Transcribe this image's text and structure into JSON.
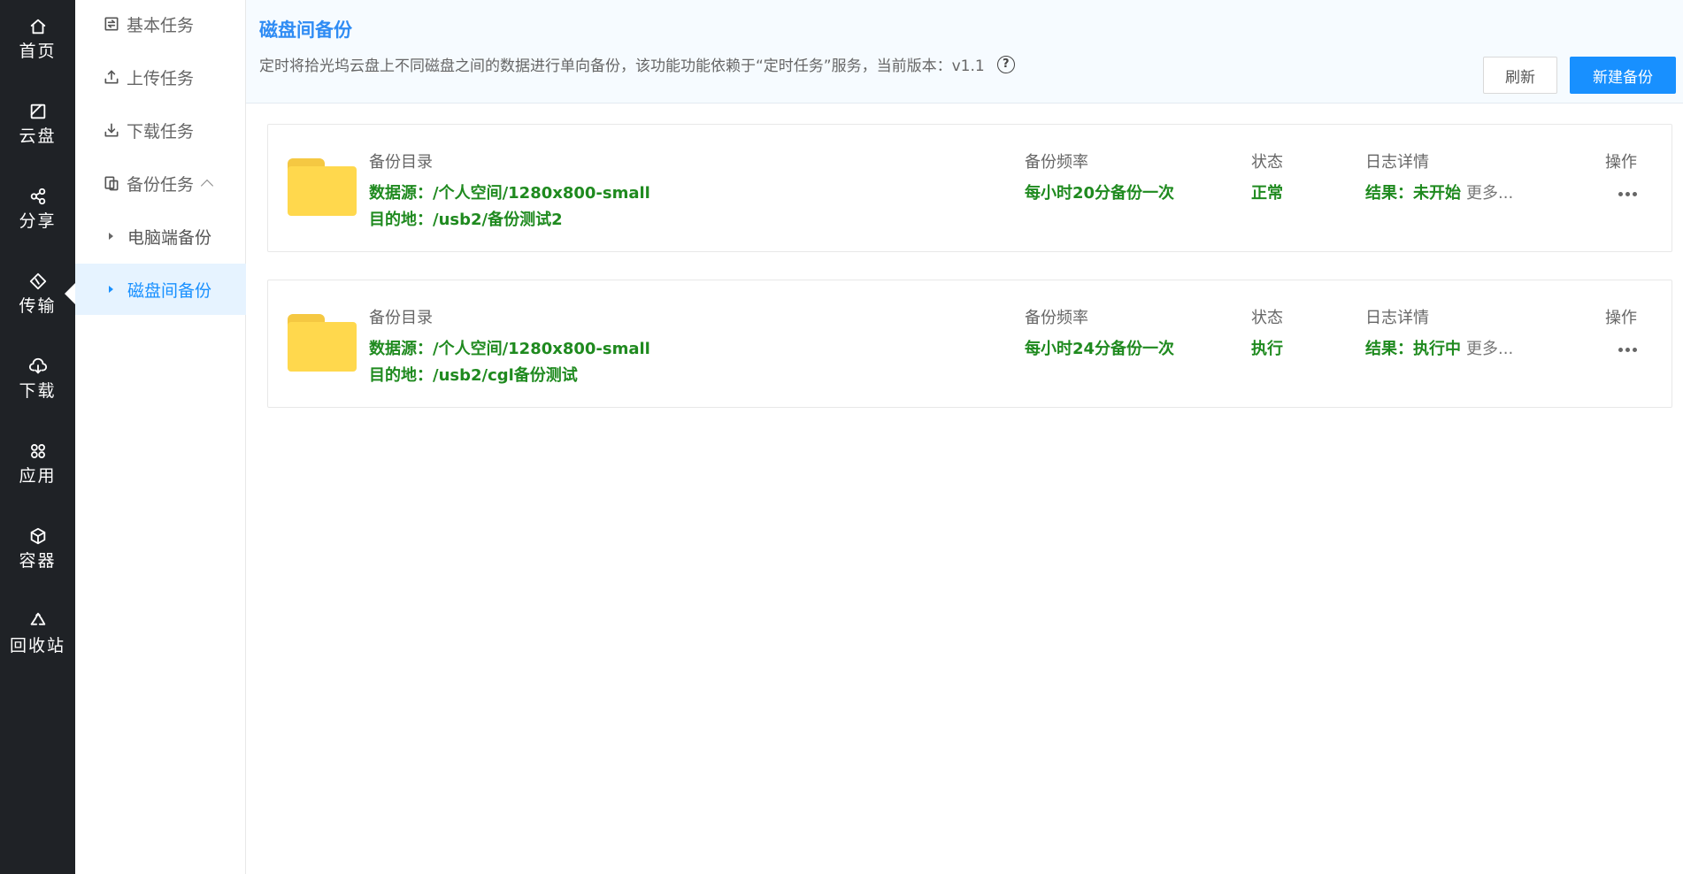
{
  "nav": {
    "items": [
      {
        "label": "首页",
        "icon": "home-icon"
      },
      {
        "label": "云盘",
        "icon": "cloud-disk-icon"
      },
      {
        "label": "分享",
        "icon": "share-icon"
      },
      {
        "label": "传输",
        "icon": "transfer-icon"
      },
      {
        "label": "下载",
        "icon": "download-cloud-icon"
      },
      {
        "label": "应用",
        "icon": "apps-icon"
      },
      {
        "label": "容器",
        "icon": "container-icon"
      },
      {
        "label": "回收站",
        "icon": "recycle-icon"
      }
    ],
    "active": "传输"
  },
  "submenu": {
    "basic": "基本任务",
    "upload": "上传任务",
    "download": "下载任务",
    "backup": "备份任务",
    "children": {
      "pc_backup": "电脑端备份",
      "disk_backup": "磁盘间备份"
    },
    "active": "磁盘间备份"
  },
  "header": {
    "title": "磁盘间备份",
    "description": "定时将拾光坞云盘上不同磁盘之间的数据进行单向备份，该功能功能依赖于“定时任务”服务，当前版本：v1.1",
    "help": "?",
    "refresh_label": "刷新",
    "new_label": "新建备份"
  },
  "columns": {
    "dir": "备份目录",
    "freq": "备份频率",
    "status": "状态",
    "log": "日志详情",
    "ops": "操作"
  },
  "tasks": [
    {
      "source": "数据源：/个人空间/1280x800-small",
      "dest": "目的地：/usb2/备份测试2",
      "freq": "每小时20分备份一次",
      "status": "正常",
      "result": "结果：未开始",
      "more": "更多..."
    },
    {
      "source": "数据源：/个人空间/1280x800-small",
      "dest": "目的地：/usb2/cgl备份测试",
      "freq": "每小时24分备份一次",
      "status": "执行",
      "result": "结果：执行中",
      "more": "更多..."
    }
  ],
  "colors": {
    "accent": "#1890ff",
    "title": "#2f8cf4",
    "ok_green": "#1f8a1f",
    "nav_bg": "#1f2226",
    "folder": "#ffd84d"
  }
}
